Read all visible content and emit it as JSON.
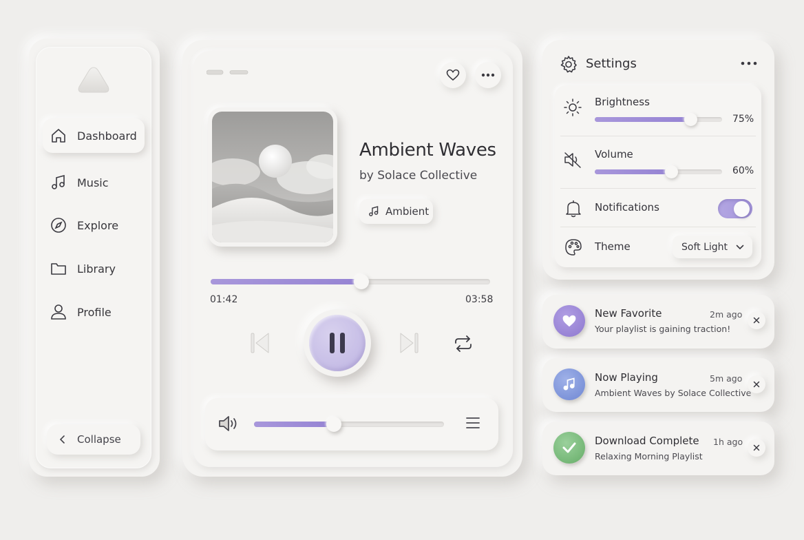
{
  "sidebar": {
    "logo_icon": "triangle-logo-icon",
    "items": [
      {
        "label": "Dashboard",
        "icon": "home-icon",
        "active": true
      },
      {
        "label": "Music",
        "icon": "music-note-icon",
        "active": false
      },
      {
        "label": "Explore",
        "icon": "compass-icon",
        "active": false
      },
      {
        "label": "Library",
        "icon": "folder-icon",
        "active": false
      },
      {
        "label": "Profile",
        "icon": "user-icon",
        "active": false
      }
    ],
    "collapse_label": "Collapse"
  },
  "player": {
    "title": "Ambient Waves",
    "artist": "by Solace Collective",
    "genre": "Ambient",
    "elapsed": "01:42",
    "total": "03:58",
    "progress": 0.54,
    "volume": 0.42,
    "state": "playing"
  },
  "settings": {
    "title": "Settings",
    "brightness": {
      "label": "Brightness",
      "value": 75,
      "display": "75%"
    },
    "volume": {
      "label": "Volume",
      "value": 60,
      "display": "60%"
    },
    "notifications": {
      "label": "Notifications",
      "enabled": true
    },
    "theme": {
      "label": "Theme",
      "selected": "Soft Light"
    }
  },
  "notifications": [
    {
      "title": "New Favorite",
      "time": "2m ago",
      "message": "Your playlist is gaining traction!",
      "icon": "heart-icon",
      "color": "#9b86d6"
    },
    {
      "title": "Now Playing",
      "time": "5m ago",
      "message": "Ambient Waves by Solace Collective",
      "icon": "music-note-icon",
      "color": "#7b93d9"
    },
    {
      "title": "Download Complete",
      "time": "1h ago",
      "message": "Relaxing Morning Playlist",
      "icon": "check-icon",
      "color": "#74b876"
    }
  ],
  "colors": {
    "accent": "#9583d3",
    "background": "#efeeec",
    "surface": "#f4f3f1"
  }
}
